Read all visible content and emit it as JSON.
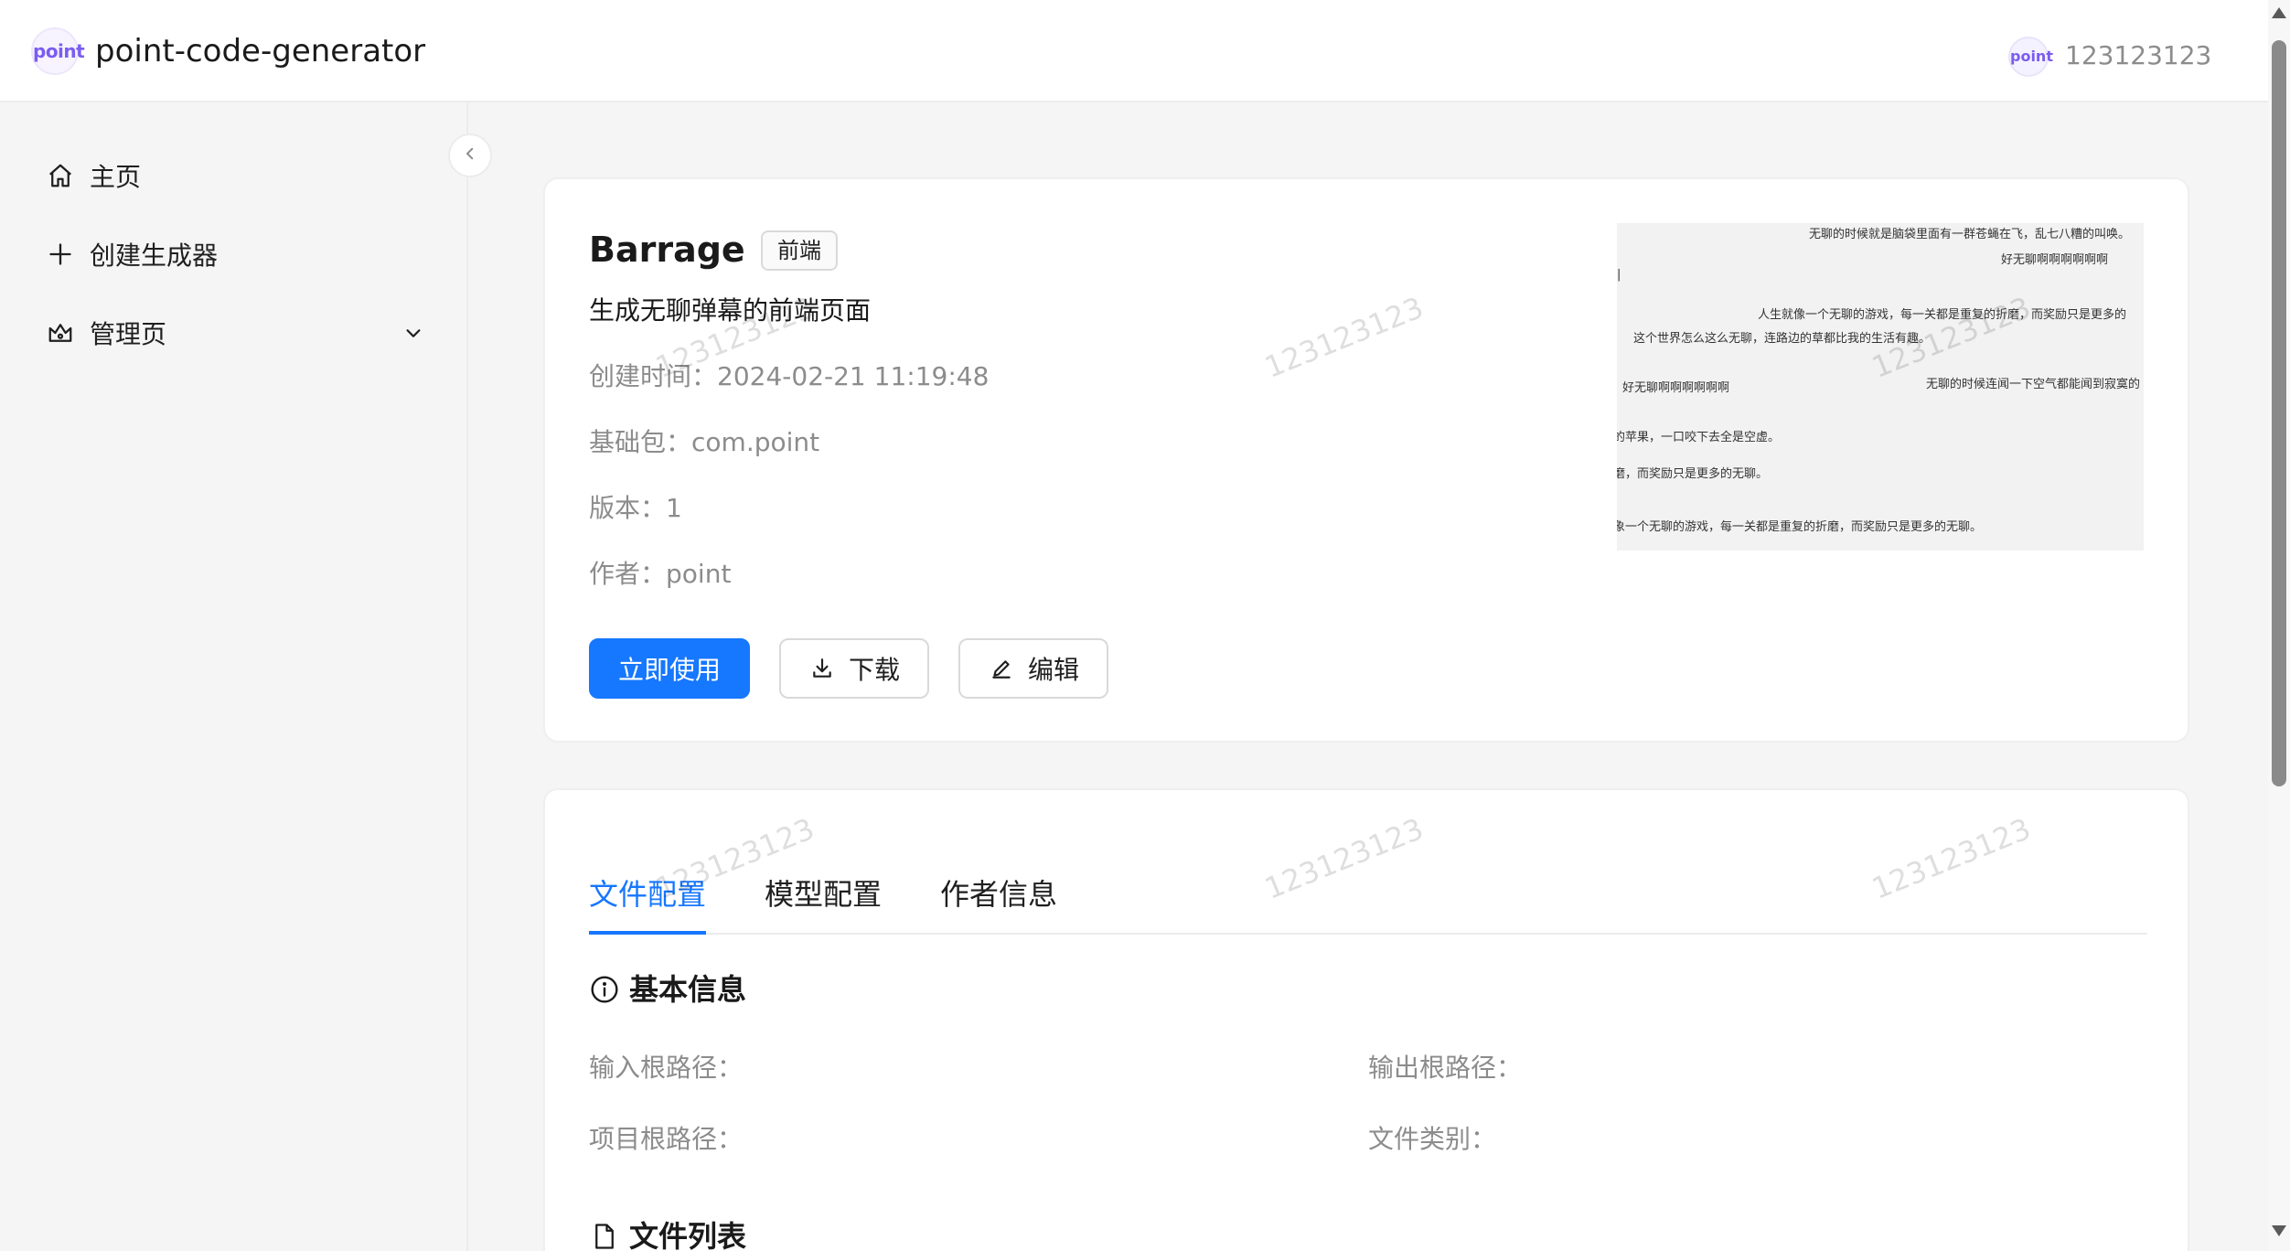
{
  "header": {
    "logo_text": "point",
    "title": "point-code-generator",
    "avatar_text": "point",
    "username": "123123123"
  },
  "sidebar": {
    "items": [
      {
        "label": "主页",
        "icon": "home-icon"
      },
      {
        "label": "创建生成器",
        "icon": "plus-icon"
      },
      {
        "label": "管理页",
        "icon": "crown-icon",
        "expandable": true
      }
    ]
  },
  "generator": {
    "name": "Barrage",
    "tag": "前端",
    "description": "生成无聊弹幕的前端页面",
    "created_label": "创建时间：",
    "created_value": "2024-02-21 11:19:48",
    "package_label": "基础包：",
    "package_value": "com.point",
    "version_label": "版本：",
    "version_value": "1",
    "author_label": "作者：",
    "author_value": "point",
    "use_button": "立即使用",
    "download_button": "下载",
    "edit_button": "编辑"
  },
  "preview": {
    "lines": [
      "无聊的时候就是脑袋里面有一群苍蝇在飞，乱七八糟的叫唤。",
      "好无聊啊啊啊啊啊啊",
      "人生就像一个无聊的游戏，每一关都是重复的折磨，而奖励只是更多的",
      "这个世界怎么这么无聊，连路边的草都比我的生活有趣。",
      "好无聊啊啊啊啊啊啊",
      "无聊的时候连闻一下空气都能闻到寂寞的",
      "的苹果，一口咬下去全是空虚。",
      "磨，而奖励只是更多的无聊。",
      "象一个无聊的游戏，每一关都是重复的折磨，而奖励只是更多的无聊。"
    ]
  },
  "tabs": [
    {
      "label": "文件配置",
      "active": true
    },
    {
      "label": "模型配置",
      "active": false
    },
    {
      "label": "作者信息",
      "active": false
    }
  ],
  "file_config": {
    "basic_info_title": "基本信息",
    "input_root_label": "输入根路径：",
    "output_root_label": "输出根路径：",
    "project_root_label": "项目根路径：",
    "file_type_label": "文件类别：",
    "file_list_title": "文件列表"
  },
  "watermark_text": "123123123",
  "colors": {
    "primary": "#1677ff",
    "logo_purple": "#7b5cf0",
    "muted_text": "#8c8c8c",
    "page_bg": "#f5f5f5"
  }
}
